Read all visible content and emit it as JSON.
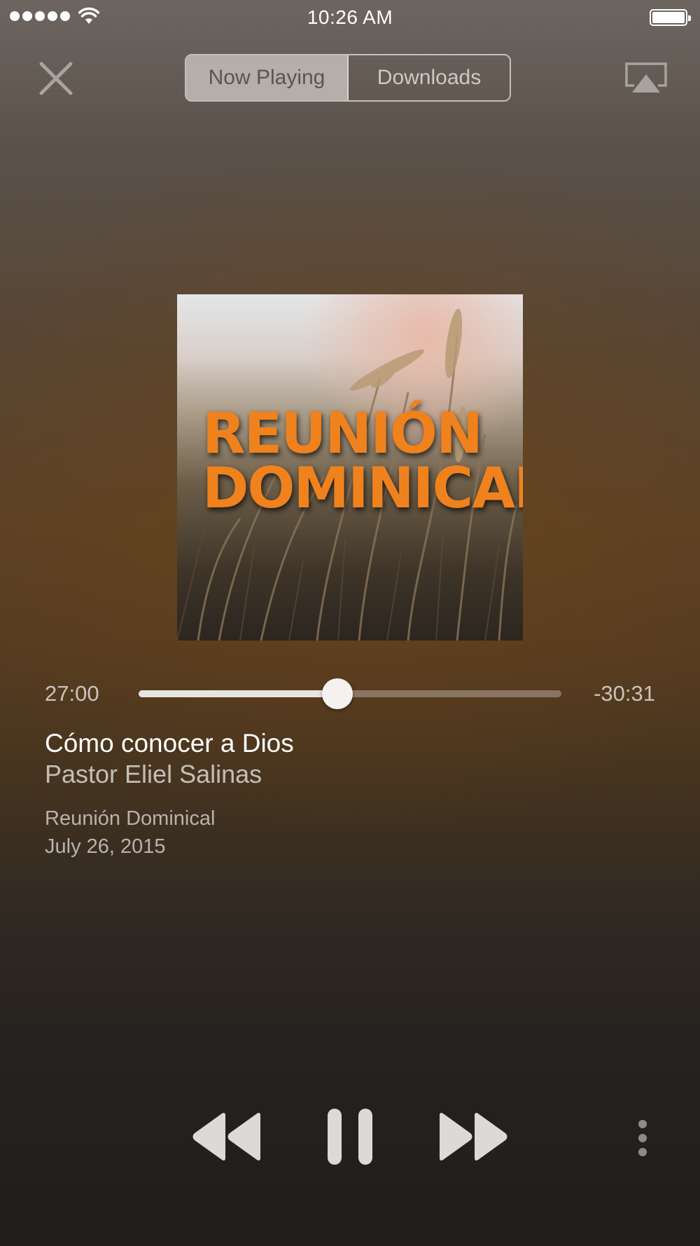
{
  "status_bar": {
    "time": "10:26 AM",
    "signal_bars": 5,
    "battery_level": 1.0
  },
  "header": {
    "close_icon": "close-icon",
    "tabs": [
      {
        "label": "Now Playing",
        "selected": true
      },
      {
        "label": "Downloads",
        "selected": false
      }
    ],
    "airplay_icon": "airplay-icon"
  },
  "artwork": {
    "title_line1": "REUNIÓN",
    "title_line2": "DOMINICAL",
    "accent": "#f0821e"
  },
  "player": {
    "elapsed": "27:00",
    "remaining": "-30:31",
    "progress": 0.47
  },
  "track": {
    "title": "Cómo conocer a Dios",
    "speaker": "Pastor Eliel Salinas",
    "series": "Reunión Dominical",
    "date": "July 26, 2015"
  },
  "controls": {
    "rewind_icon": "rewind-icon",
    "pause_icon": "pause-icon",
    "fast_forward_icon": "fast-forward-icon",
    "more_icon": "more-vertical-icon"
  }
}
